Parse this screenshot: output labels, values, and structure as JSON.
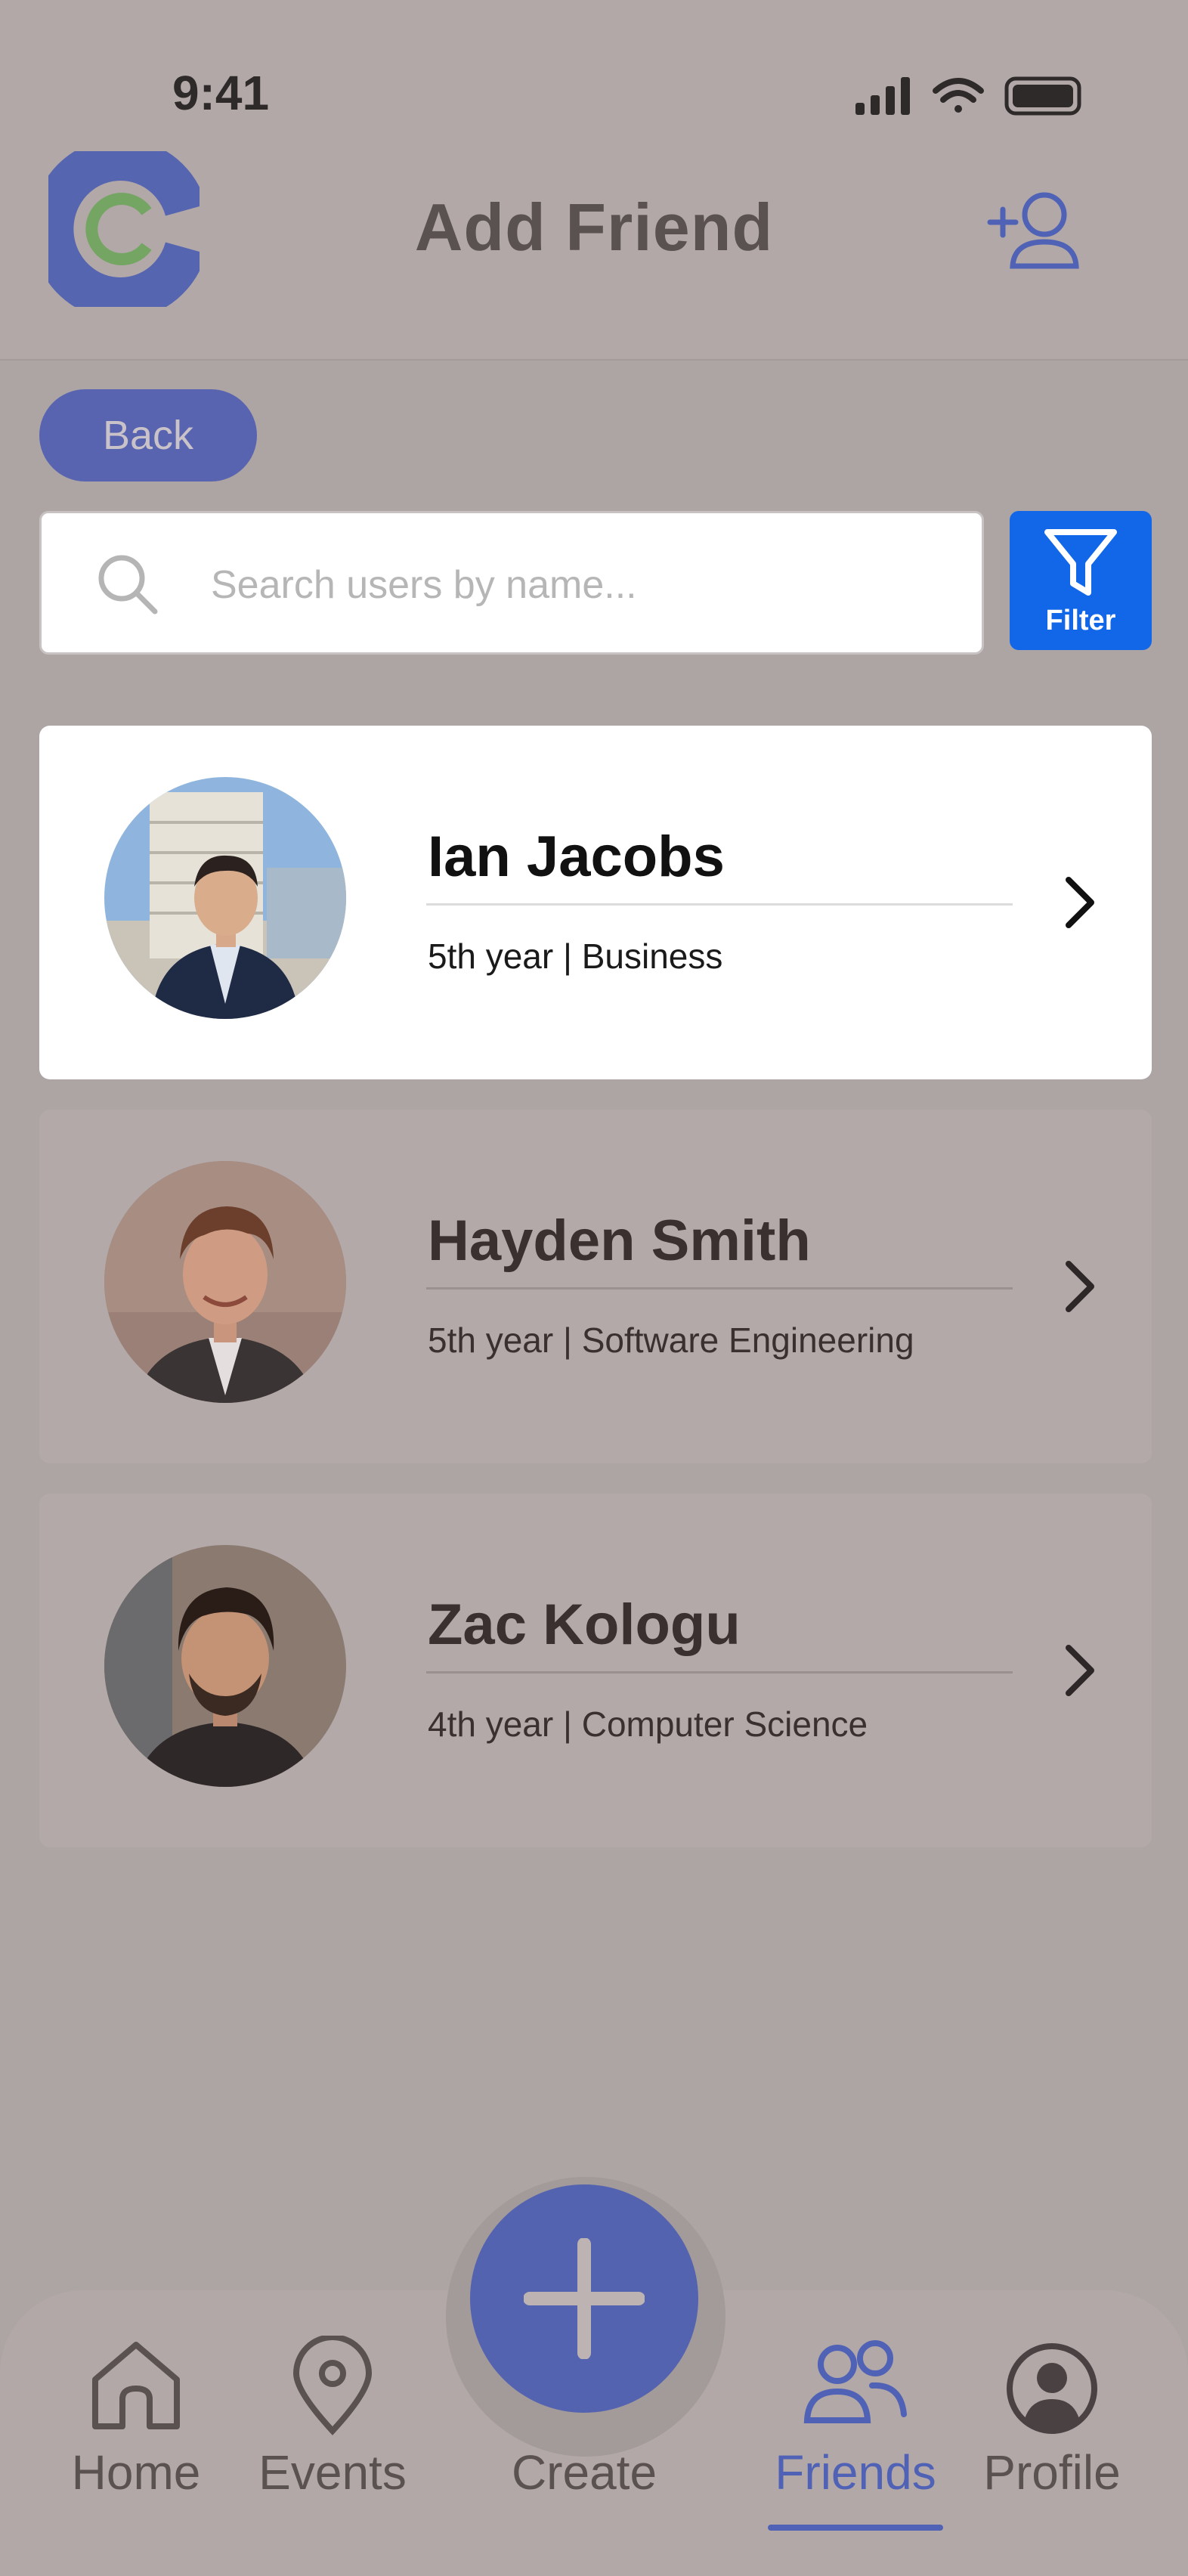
{
  "status_bar": {
    "time": "9:41"
  },
  "header": {
    "title": "Add Friend"
  },
  "back_button": {
    "label": "Back"
  },
  "search": {
    "placeholder": "Search users by name..."
  },
  "filter": {
    "label": "Filter"
  },
  "users": [
    {
      "name": "Ian Jacobs",
      "details": "5th year | Business",
      "selected": true
    },
    {
      "name": "Hayden Smith",
      "details": "5th year | Software Engineering",
      "selected": false
    },
    {
      "name": "Zac Kologu",
      "details": "4th year | Computer Science",
      "selected": false
    }
  ],
  "nav": {
    "home": "Home",
    "events": "Events",
    "create": "Create",
    "friends": "Friends",
    "profile": "Profile",
    "active": "friends"
  },
  "colors": {
    "accent": "#4f62b5",
    "filter_blue": "#1167e8",
    "overlay": "#ada4a4"
  }
}
